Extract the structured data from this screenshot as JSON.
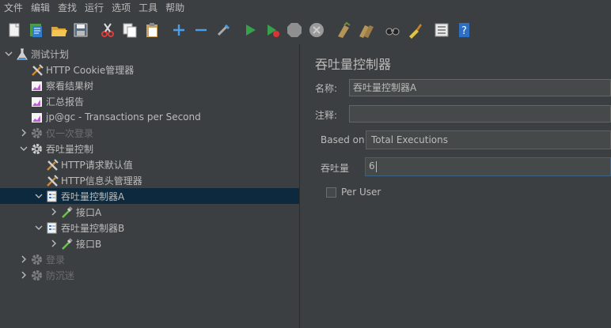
{
  "menu": [
    "文件",
    "编辑",
    "查找",
    "运行",
    "选项",
    "工具",
    "帮助"
  ],
  "toolbar": {
    "icons": [
      "new-file-icon",
      "templates-icon",
      "open-folder-icon",
      "save-icon",
      "cut-icon",
      "copy-icon",
      "paste-icon",
      "expand-icon",
      "collapse-icon",
      "toggle-icon",
      "start-icon",
      "start-no-pauses-icon",
      "stop-icon",
      "shutdown-icon",
      "clear-icon",
      "clear-all-icon",
      "search-icon",
      "reset-search-icon",
      "function-helper-icon",
      "help-icon"
    ]
  },
  "tree": {
    "nodes": [
      {
        "label": "测试计划",
        "icon": "flask-icon",
        "level": 0,
        "expanded": true,
        "disabled": false,
        "selected": false
      },
      {
        "label": "HTTP Cookie管理器",
        "icon": "wrench-icon",
        "level": 1,
        "disabled": false,
        "selected": false
      },
      {
        "label": "察看结果树",
        "icon": "listener-icon",
        "level": 1,
        "disabled": false,
        "selected": false
      },
      {
        "label": "汇总报告",
        "icon": "listener-icon",
        "level": 1,
        "disabled": false,
        "selected": false
      },
      {
        "label": "jp@gc - Transactions per Second",
        "icon": "listener-icon",
        "level": 1,
        "disabled": false,
        "selected": false
      },
      {
        "label": "仅一次登录",
        "icon": "gear-icon",
        "level": 1,
        "expanded": false,
        "disabled": true,
        "selected": false
      },
      {
        "label": "吞吐量控制",
        "icon": "gear-icon",
        "level": 1,
        "expanded": true,
        "disabled": false,
        "selected": false
      },
      {
        "label": "HTTP请求默认值",
        "icon": "wrench-icon",
        "level": 2,
        "disabled": false,
        "selected": false
      },
      {
        "label": "HTTP信息头管理器",
        "icon": "wrench-icon",
        "level": 2,
        "disabled": false,
        "selected": false
      },
      {
        "label": "吞吐量控制器A",
        "icon": "controller-icon",
        "level": 2,
        "expanded": true,
        "disabled": false,
        "selected": true
      },
      {
        "label": "接口A",
        "icon": "pipette-icon",
        "level": 3,
        "expanded": false,
        "disabled": false,
        "selected": false
      },
      {
        "label": "吞吐量控制器B",
        "icon": "controller-icon",
        "level": 2,
        "expanded": true,
        "disabled": false,
        "selected": false
      },
      {
        "label": "接口B",
        "icon": "pipette-icon",
        "level": 3,
        "expanded": false,
        "disabled": false,
        "selected": false
      },
      {
        "label": "登录",
        "icon": "gear-icon",
        "level": 1,
        "expanded": false,
        "disabled": true,
        "selected": false
      },
      {
        "label": "防沉迷",
        "icon": "gear-icon",
        "level": 1,
        "expanded": false,
        "disabled": true,
        "selected": false
      }
    ]
  },
  "panel": {
    "title": "吞吐量控制器",
    "name_label": "名称:",
    "name_value": "吞吐量控制器A",
    "comment_label": "注释:",
    "comment_value": "",
    "based_on_label": "Based on",
    "based_on_value": "Total Executions",
    "throughput_label": "吞吐量",
    "throughput_value": "6",
    "per_user_label": "Per User",
    "per_user_checked": false
  },
  "colors": {
    "background": "#3c3f41",
    "selection": "#0d293e",
    "text": "#bbbbbb",
    "disabled_text": "#6e6e6e",
    "field_focus": "#3d6185"
  }
}
